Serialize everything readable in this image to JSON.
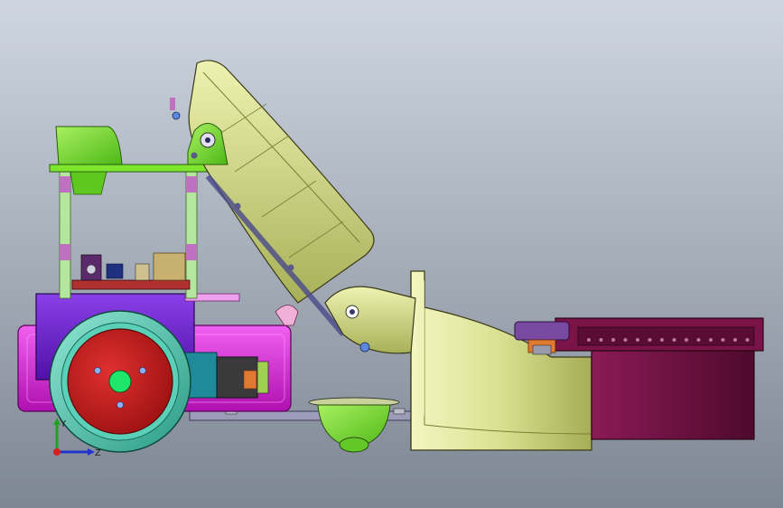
{
  "viewport": {
    "background_top": "#cfd6e0",
    "background_bottom": "#7d8693"
  },
  "triad": {
    "y_label": "Y",
    "z_label": "Z",
    "y_color": "#1fa31f",
    "z_color": "#2233cc",
    "origin_color": "#d42020"
  },
  "colors": {
    "arm_yellow": "#d9e090",
    "chassis_purple": "#6a1ec8",
    "battery_magenta": "#e61ee6",
    "wheel_tire": "#52c8b0",
    "wheel_hub": "#c81e1e",
    "hub_center": "#1ee66a",
    "upper_green": "#7ee62e",
    "standoff_green": "#b4e6a0",
    "motor_teal": "#1e8a9a",
    "gripper_maroon": "#6e1040",
    "plate_gray": "#8c8ca8",
    "pcb_red": "#b03030"
  }
}
